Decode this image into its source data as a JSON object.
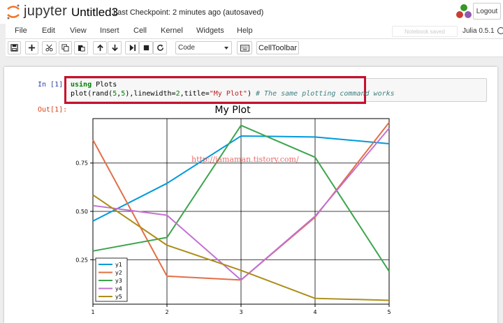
{
  "header": {
    "logo_text": "jupyter",
    "notebook_name": "Untitled3",
    "checkpoint": "Last Checkpoint: 2 minutes ago (autosaved)",
    "logout_label": "Logout"
  },
  "menubar": {
    "items": [
      "File",
      "Edit",
      "View",
      "Insert",
      "Cell",
      "Kernel",
      "Widgets",
      "Help"
    ],
    "notebook_saved": "Notebook saved",
    "kernel_name": "Julia 0.5.1"
  },
  "toolbar": {
    "cell_type": "Code",
    "celltoolbar_label": "CellToolbar",
    "icons": [
      "save-icon",
      "plus-icon",
      "cut-icon",
      "copy-icon",
      "paste-icon",
      "arrow-up-icon",
      "arrow-down-icon",
      "step-forward-icon",
      "stop-icon",
      "refresh-icon",
      "keyboard-icon"
    ]
  },
  "cell": {
    "in_prompt": "In [1]:",
    "out_prompt": "Out[1]:",
    "code_line1_kw": "using",
    "code_line1_rest": " Plots",
    "code_line2_a": "plot(rand(",
    "code_line2_n1": "5",
    "code_line2_b": ",",
    "code_line2_n2": "5",
    "code_line2_c": "),linewidth=",
    "code_line2_n3": "2",
    "code_line2_d": ",title=",
    "code_line2_str": "\"My Plot\"",
    "code_line2_e": ") ",
    "code_line2_comment": "# The same plotting command works"
  },
  "watermark": "http://jamaman.tistory.com/",
  "chart_data": {
    "type": "line",
    "title": "My Plot",
    "xlabel": "",
    "ylabel": "",
    "x": [
      1,
      2,
      3,
      4,
      5
    ],
    "xlim": [
      1,
      5
    ],
    "ylim": [
      0.02,
      0.98
    ],
    "xticks": [
      "1",
      "2",
      "3",
      "4",
      "5"
    ],
    "yticks": [
      0.25,
      0.5,
      0.75
    ],
    "ytick_labels": [
      "0.25",
      "0.50",
      "0.75"
    ],
    "grid": true,
    "legend_position": "bottom-left",
    "series": [
      {
        "name": "y1",
        "color": "#0099dd",
        "values": [
          0.45,
          0.645,
          0.89,
          0.885,
          0.85
        ]
      },
      {
        "name": "y2",
        "color": "#e26f46",
        "values": [
          0.87,
          0.165,
          0.145,
          0.47,
          0.96
        ]
      },
      {
        "name": "y3",
        "color": "#3da44d",
        "values": [
          0.295,
          0.365,
          0.945,
          0.78,
          0.19
        ]
      },
      {
        "name": "y4",
        "color": "#c271d2",
        "values": [
          0.53,
          0.48,
          0.145,
          0.475,
          0.93
        ]
      },
      {
        "name": "y5",
        "color": "#ac8d18",
        "values": [
          0.585,
          0.325,
          0.195,
          0.05,
          0.04
        ]
      }
    ]
  }
}
